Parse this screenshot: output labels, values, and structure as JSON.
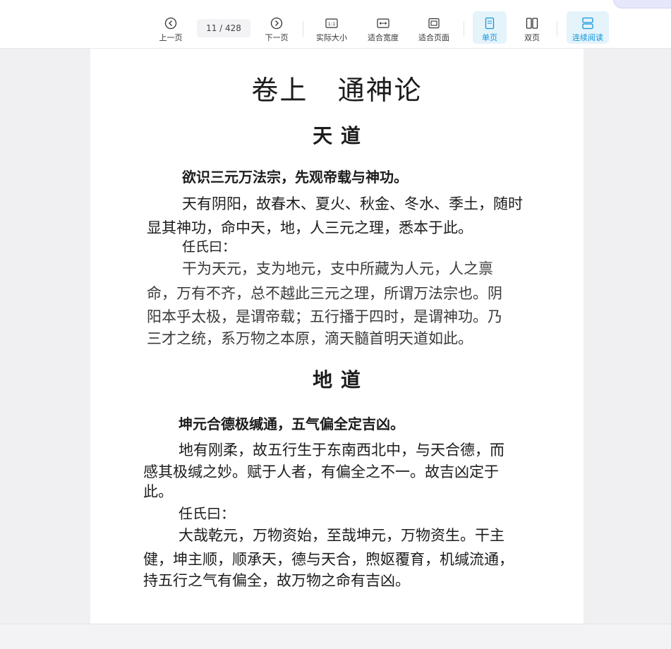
{
  "toolbar": {
    "prev_label": "上一页",
    "page_indicator": "11 / 428",
    "next_label": "下一页",
    "actual_size_label": "实际大小",
    "fit_width_label": "适合宽度",
    "fit_page_label": "适合页面",
    "single_page_label": "单页",
    "double_page_label": "双页",
    "continuous_label": "连续阅读",
    "actual_size_icon_text": "1:1",
    "accent_color": "#1296db"
  },
  "document": {
    "chapter_title": "卷上   通神论",
    "section1": {
      "title": "天   道",
      "lines": [
        "欲识三元万法宗，先观帝载与神功。",
        "天有阴阳，故春木、夏火、秋金、冬水、季土，随时",
        "显其神功，命中天，地，人三元之理，悉本于此。",
        "任氏曰：",
        "干为天元，支为地元，支中所藏为人元，人之禀",
        "命，万有不齐，总不越此三元之理，所谓万法宗也。阴",
        "阳本乎太极，是谓帝载；五行播于四时，是谓神功。乃",
        "三才之统，系万物之本原，滴天髓首明天道如此。"
      ]
    },
    "section2": {
      "title": "地   道",
      "lines": [
        "坤元合德极缄通，五气偏全定吉凶。",
        "地有刚柔，故五行生于东南西北中，与天合德，而",
        "感其极缄之妙。赋于人者，有偏全之不一。故吉凶定于",
        "此。",
        "任氏曰：",
        "大哉乾元，万物资始，至哉坤元，万物资生。干主",
        "健，坤主顺，顺承天，德与天合，煦妪覆育，机缄流通，",
        "持五行之气有偏全，故万物之命有吉凶。"
      ]
    }
  }
}
